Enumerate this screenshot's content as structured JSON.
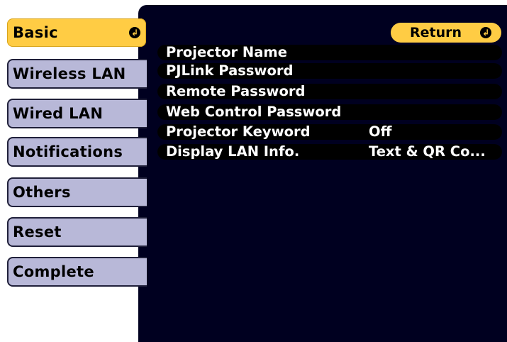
{
  "tabs": [
    {
      "label": "Basic",
      "active": true
    },
    {
      "label": "Wireless LAN"
    },
    {
      "label": "Wired LAN"
    },
    {
      "label": "Notifications"
    },
    {
      "label": "Others"
    },
    {
      "label": "Reset"
    },
    {
      "label": "Complete"
    }
  ],
  "return_label": "Return",
  "icons": {
    "enter": "enter-icon"
  },
  "colors": {
    "accent": "#ffcc44",
    "tab": "#b8b8d8",
    "panel": "#000020"
  },
  "settings": [
    {
      "label": "Projector Name",
      "value": ""
    },
    {
      "label": "PJLink Password",
      "value": ""
    },
    {
      "label": "Remote Password",
      "value": ""
    },
    {
      "label": "Web Control Password",
      "value": ""
    },
    {
      "label": "Projector Keyword",
      "value": "Off"
    },
    {
      "label": "Display LAN Info.",
      "value": "Text & QR Co..."
    }
  ]
}
